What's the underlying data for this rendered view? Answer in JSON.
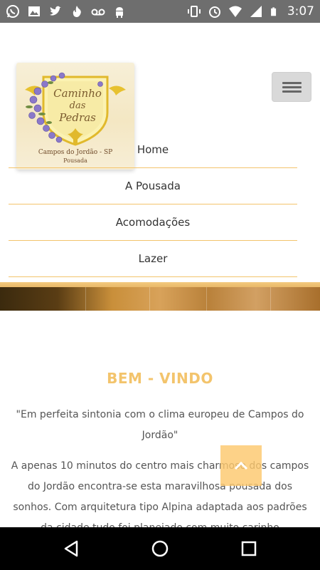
{
  "status_bar": {
    "time": "3:07",
    "left_icons": [
      "whatsapp-icon",
      "image-icon",
      "twitter-icon",
      "tinder-icon",
      "voicemail-icon",
      "android-icon"
    ],
    "right_icons": [
      "vibrate-icon",
      "alarm-icon",
      "wifi-icon",
      "signal-icon",
      "battery-icon"
    ]
  },
  "logo": {
    "title_line1": "Caminho",
    "title_line2": "das",
    "title_line3": "Pedras",
    "subtitle": "Campos do Jordão - SP",
    "tagline": "Pousada"
  },
  "menu": {
    "items": [
      {
        "label": "Home"
      },
      {
        "label": "A Pousada"
      },
      {
        "label": "Acomodações"
      },
      {
        "label": "Lazer"
      }
    ]
  },
  "content": {
    "heading": "BEM - VINDO",
    "quote": "\"Em perfeita sintonia com o clima europeu de Campos do Jordão\"",
    "body": "A apenas 10 minutos do centro mais charmoso dos campos do Jordão encontra-se esta maravilhosa pousada dos sonhos. Com arquitetura tipo Alpina adaptada aos padrões da cidade tudo foi planejado com muito carinho"
  },
  "colors": {
    "accent": "#f3c46c",
    "status_bar": "#6e6e6e",
    "nav_bar": "#000000",
    "text": "#555555"
  }
}
